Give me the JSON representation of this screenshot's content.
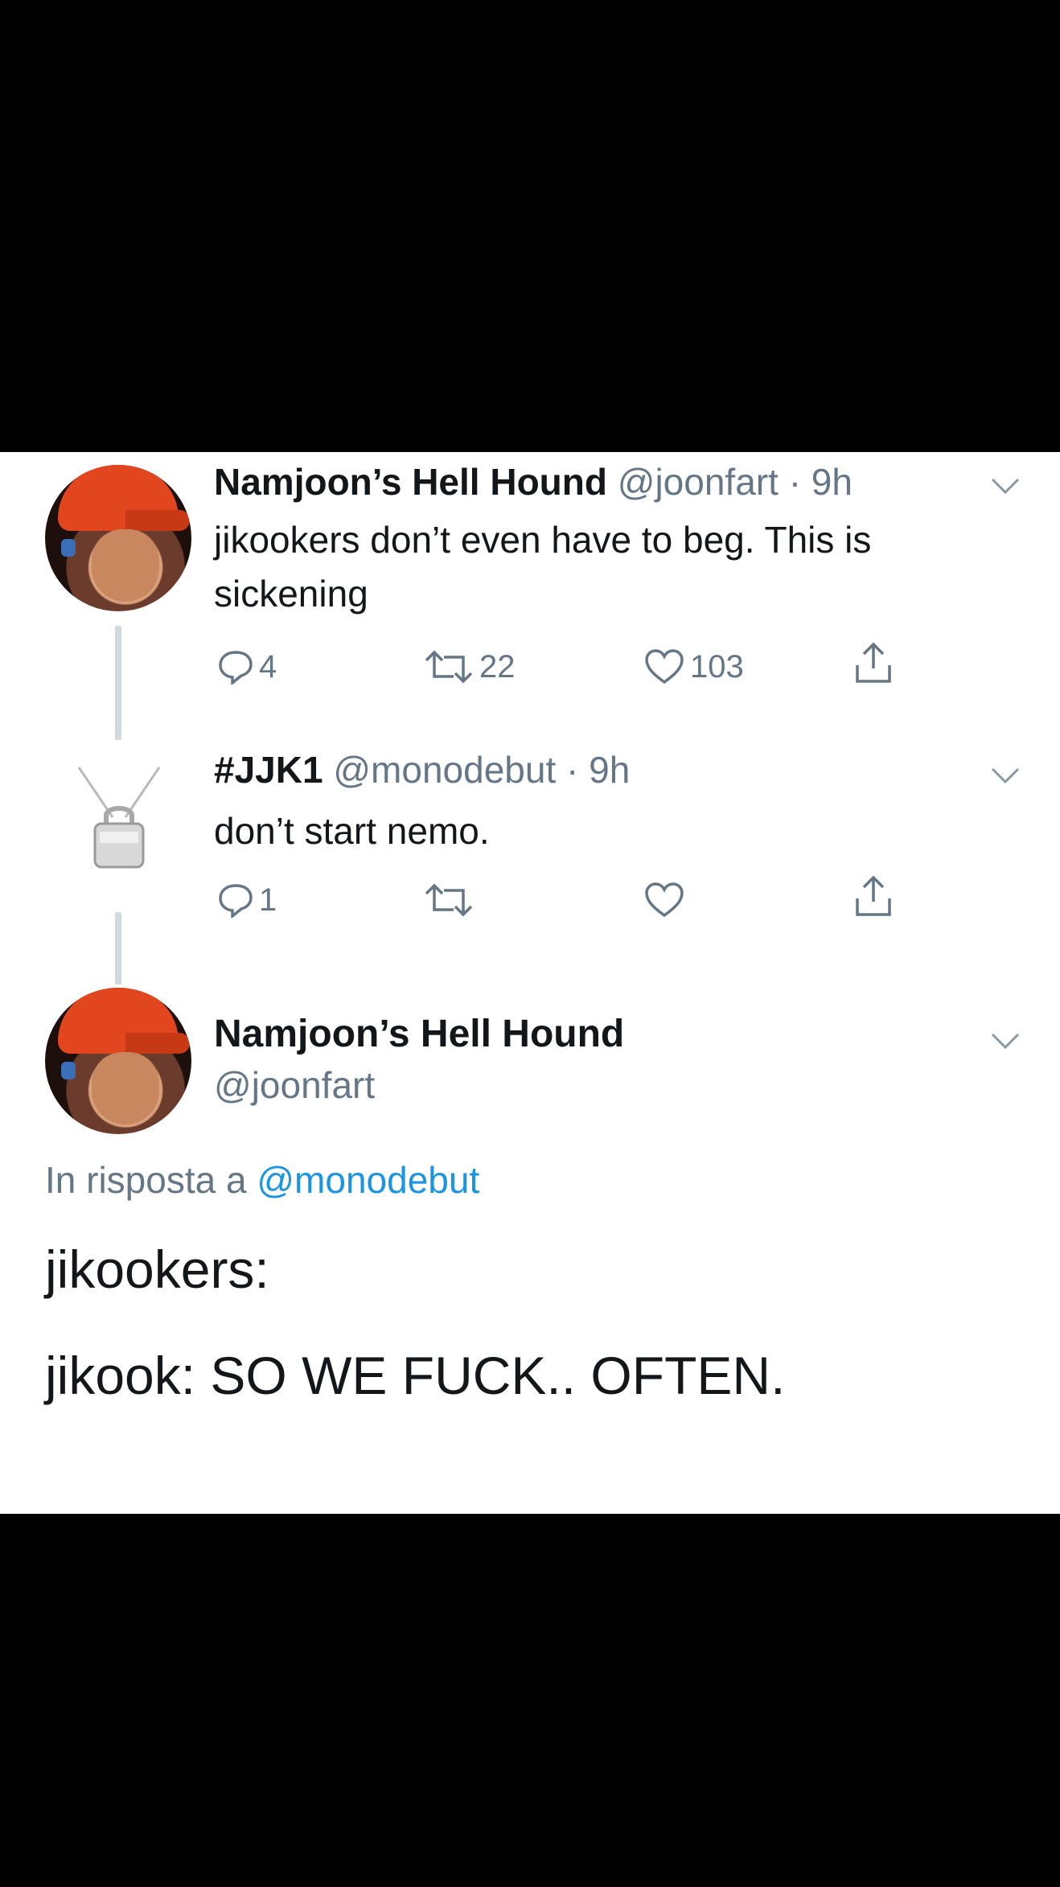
{
  "tweet1": {
    "name": "Namjoon’s Hell Hound",
    "handle": "@joonfart",
    "time": "· 9h",
    "text_line1": "jikookers don’t even have to beg.  This is",
    "text_line2": "sickening",
    "replies": "4",
    "retweets": "22",
    "likes": "103"
  },
  "tweet2": {
    "name": "#JJK1",
    "handle": "@monodebut",
    "time": "· 9h",
    "text": "don’t start nemo.",
    "replies": "1"
  },
  "tweet3": {
    "name": "Namjoon’s Hell Hound",
    "handle": "@joonfart",
    "reply_prefix": "In risposta a",
    "reply_mention": "@monodebut",
    "line1": "jikookers:",
    "line2": "jikook: SO WE FUCK..  OFTEN."
  },
  "colors": {
    "text": "#14171a",
    "secondary": "#657786",
    "link": "#1b95e0",
    "cap": "#e2461f"
  }
}
